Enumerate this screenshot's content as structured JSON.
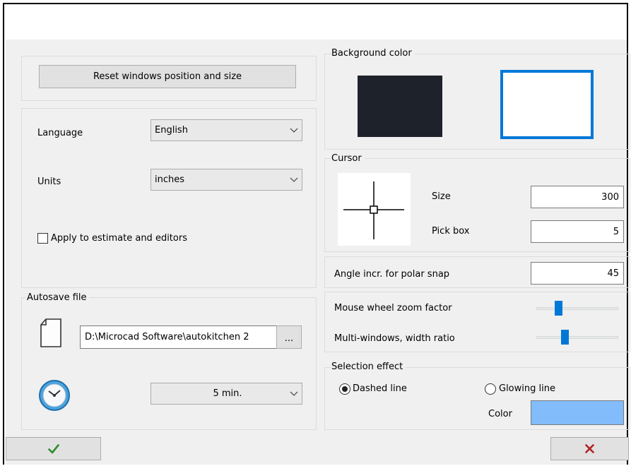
{
  "reset_button": {
    "label": "Reset windows position and size"
  },
  "settings": {
    "language_label": "Language",
    "language_value": "English",
    "units_label": "Units",
    "units_value": "inches",
    "apply_label": "Apply to estimate and editors",
    "apply_checked": false
  },
  "autosave": {
    "title": "Autosave file",
    "path": "D:\\Microcad Software\\autokitchen 2",
    "browse_label": "...",
    "interval_value": "5 min."
  },
  "background": {
    "title": "Background color",
    "dark_color": "#1e222b",
    "light_color": "#ffffff",
    "selected": "light",
    "selection_color": "#0078d7"
  },
  "cursor": {
    "title": "Cursor",
    "size_label": "Size",
    "size_value": "300",
    "pickbox_label": "Pick box",
    "pickbox_value": "5"
  },
  "snap": {
    "angle_label": "Angle incr. for polar snap",
    "angle_value": "45"
  },
  "sliders": {
    "zoom_label": "Mouse wheel zoom factor",
    "zoom_level": 0.25,
    "width_label": "Multi-windows, width ratio",
    "width_level": 0.33
  },
  "selection": {
    "title": "Selection effect",
    "dashed_label": "Dashed line",
    "glowing_label": "Glowing line",
    "selected": "dashed",
    "color_label": "Color",
    "color": "#82bcfa"
  },
  "footer": {
    "ok_icon": "check-icon",
    "cancel_icon": "x-icon",
    "ok_color": "#2e8b2e",
    "cancel_color": "#b22222"
  }
}
